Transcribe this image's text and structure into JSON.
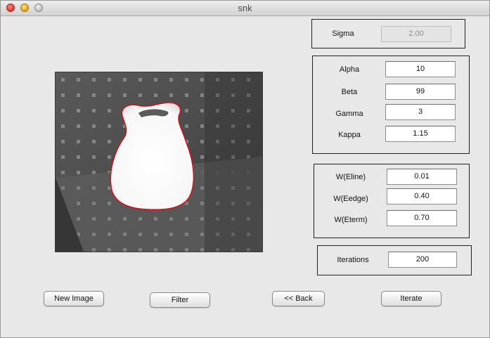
{
  "window": {
    "title": "snk"
  },
  "sigma": {
    "label": "Sigma",
    "value": "2.00"
  },
  "params": [
    {
      "label": "Alpha",
      "value": "10"
    },
    {
      "label": "Beta",
      "value": "99"
    },
    {
      "label": "Gamma",
      "value": "3"
    },
    {
      "label": "Kappa",
      "value": "1.15"
    }
  ],
  "weights": [
    {
      "label": "W(Eline)",
      "value": "0.01"
    },
    {
      "label": "W(Eedge)",
      "value": "0.40"
    },
    {
      "label": "W(Eterm)",
      "value": "0.70"
    }
  ],
  "iterations": {
    "label": "Iterations",
    "value": "200"
  },
  "buttons": {
    "new_image": "New Image",
    "filter": "Filter",
    "back": "<< Back",
    "iterate": "Iterate"
  },
  "image": {
    "contour_color": "#d0101a"
  }
}
